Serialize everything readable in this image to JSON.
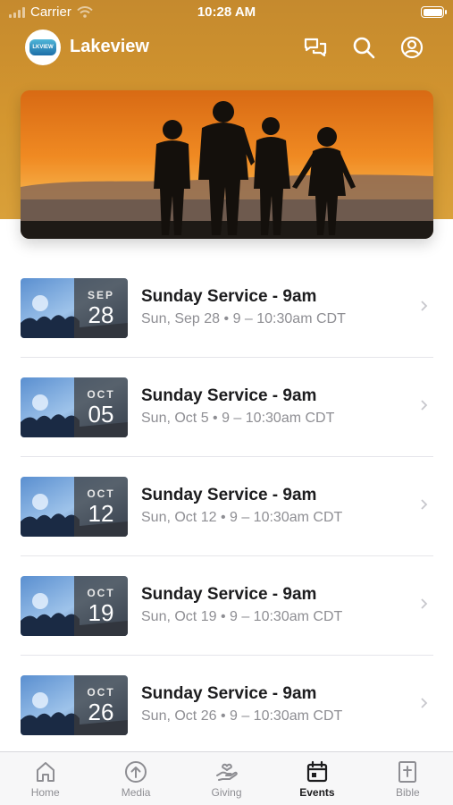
{
  "status_bar": {
    "carrier": "Carrier",
    "time": "10:28 AM",
    "icons": [
      "signal-icon",
      "wifi-icon",
      "battery-icon"
    ]
  },
  "header": {
    "app_title": "Lakeview",
    "logo_text": "LKVIEW",
    "icons": [
      "chat-icon",
      "search-icon",
      "profile-icon"
    ]
  },
  "hero": {
    "image": "family-silhouette-sunset"
  },
  "events": [
    {
      "title": "Sunday Service - 9am",
      "month": "SEP",
      "day": "28",
      "subtitle": "Sun, Sep 28 • 9 – 10:30am CDT"
    },
    {
      "title": "Sunday Service - 9am",
      "month": "OCT",
      "day": "05",
      "subtitle": "Sun, Oct 5 • 9 – 10:30am CDT"
    },
    {
      "title": "Sunday Service - 9am",
      "month": "OCT",
      "day": "12",
      "subtitle": "Sun, Oct 12 • 9 – 10:30am CDT"
    },
    {
      "title": "Sunday Service - 9am",
      "month": "OCT",
      "day": "19",
      "subtitle": "Sun, Oct 19 • 9 – 10:30am CDT"
    },
    {
      "title": "Sunday Service - 9am",
      "month": "OCT",
      "day": "26",
      "subtitle": "Sun, Oct 26 • 9 – 10:30am CDT"
    }
  ],
  "tabs": [
    {
      "label": "Home",
      "icon": "home-icon",
      "active": false
    },
    {
      "label": "Media",
      "icon": "media-icon",
      "active": false
    },
    {
      "label": "Giving",
      "icon": "giving-icon",
      "active": false
    },
    {
      "label": "Events",
      "icon": "calendar-icon",
      "active": true
    },
    {
      "label": "Bible",
      "icon": "bible-icon",
      "active": false
    }
  ],
  "colors": {
    "header": "#d4962f",
    "text_primary": "#1c1c1e",
    "text_secondary": "#8e8e93",
    "tab_inactive": "#8e8e93"
  }
}
